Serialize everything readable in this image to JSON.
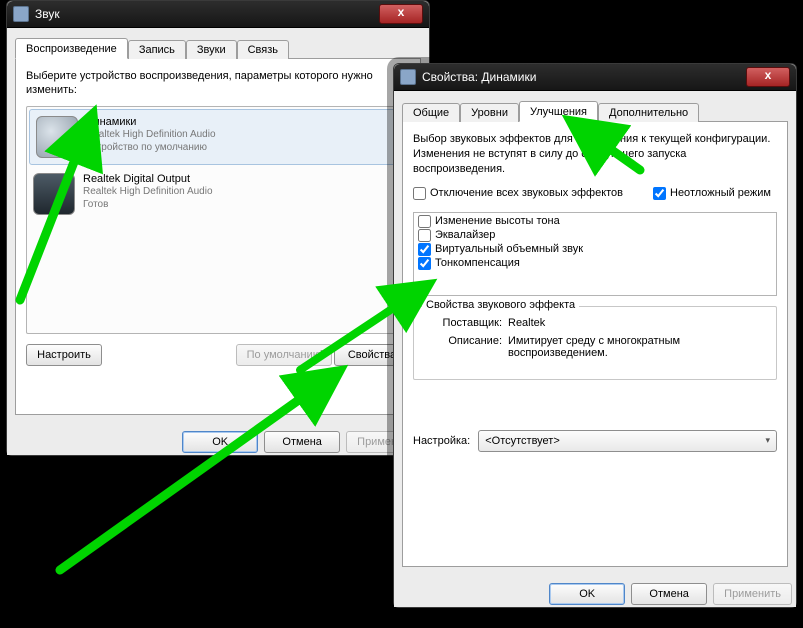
{
  "dialog1": {
    "title": "Звук",
    "tabs": [
      "Воспроизведение",
      "Запись",
      "Звуки",
      "Связь"
    ],
    "activeTab": 0,
    "instruction": "Выберите устройство воспроизведения, параметры которого нужно изменить:",
    "devices": [
      {
        "name": "Динамики",
        "driver": "Realtek High Definition Audio",
        "status": "Устройство по умолчанию",
        "default": true
      },
      {
        "name": "Realtek Digital Output",
        "driver": "Realtek High Definition Audio",
        "status": "Готов",
        "default": false
      }
    ],
    "buttons": {
      "configure": "Настроить",
      "setDefault": "По умолчанию",
      "properties": "Свойства"
    },
    "footer": {
      "ok": "OK",
      "cancel": "Отмена",
      "apply": "Применить"
    }
  },
  "dialog2": {
    "title": "Свойства: Динамики",
    "tabs": [
      "Общие",
      "Уровни",
      "Улучшения",
      "Дополнительно"
    ],
    "activeTab": 2,
    "desc": "Выбор звуковых эффектов для применения к текущей конфигурации. Изменения не вступят в силу до следующего запуска воспроизведения.",
    "disableAllLabel": "Отключение всех звуковых эффектов",
    "urgentModeLabel": "Неотложный режим",
    "urgentModeChecked": true,
    "effects": [
      {
        "label": "Изменение высоты тона",
        "checked": false
      },
      {
        "label": "Эквалайзер",
        "checked": false
      },
      {
        "label": "Виртуальный объемный звук",
        "checked": true
      },
      {
        "label": "Тонкомпенсация",
        "checked": true
      }
    ],
    "effectProps": {
      "legend": "Свойства звукового эффекта",
      "providerLabel": "Поставщик:",
      "providerValue": "Realtek",
      "descLabel": "Описание:",
      "descValue": "Имитирует среду с многократным воспроизведением."
    },
    "settingLabel": "Настройка:",
    "settingValue": "<Отсутствует>",
    "footer": {
      "ok": "OK",
      "cancel": "Отмена",
      "apply": "Применить"
    }
  }
}
